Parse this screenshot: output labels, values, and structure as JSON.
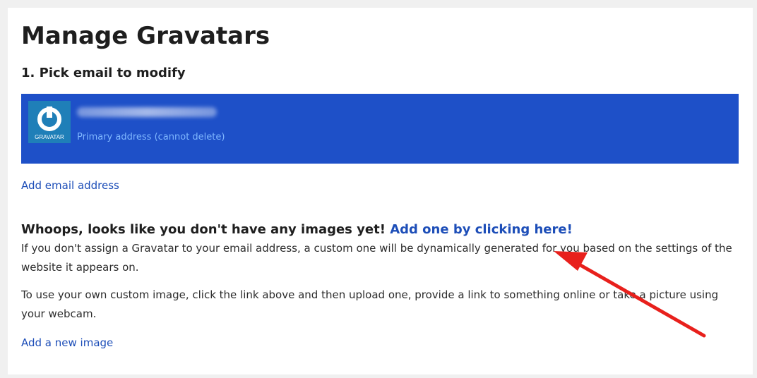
{
  "page": {
    "title": "Manage Gravatars",
    "step_heading": "1. Pick email to modify"
  },
  "email_card": {
    "avatar_icon": "gravatar-logo-icon",
    "avatar_label": "GRAVATAR",
    "email_redacted": "(blurred email address)",
    "subtext": "Primary address (cannot delete)",
    "background_color": "#1e50c8"
  },
  "links": {
    "add_email": "Add email address",
    "add_image": "Add a new image"
  },
  "no_images": {
    "heading": "Whoops, looks like you don't have any images yet!",
    "heading_link": "Add one by clicking here!",
    "paragraph_1": "If you don't assign a Gravatar to your email address, a custom one will be dynamically generated for you based on the settings of the website it appears on.",
    "paragraph_2": "To use your own custom image, click the link above and then upload one, provide a link to something online or take a picture using your webcam."
  },
  "annotation": {
    "icon": "red-arrow-icon",
    "color": "#e8201c"
  },
  "colors": {
    "link": "#1d4eb8",
    "heading": "#1e1e1e"
  }
}
